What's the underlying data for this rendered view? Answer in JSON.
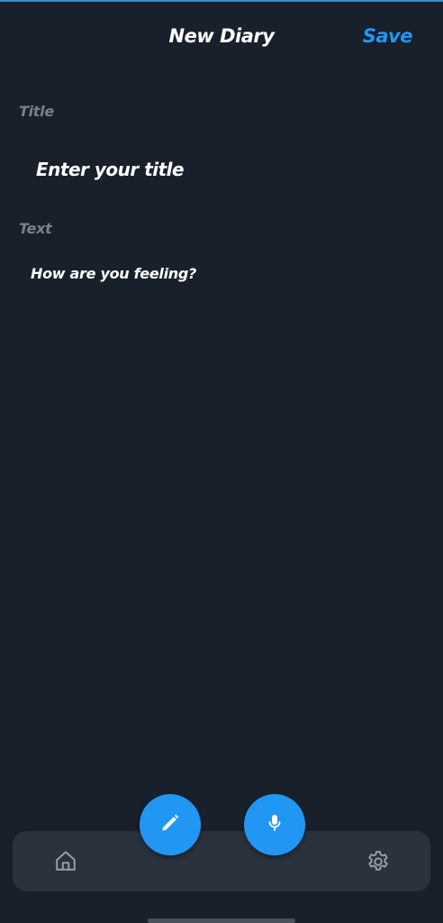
{
  "header": {
    "title": "New Diary",
    "save_label": "Save"
  },
  "form": {
    "title_label": "Title",
    "title_placeholder": "Enter your title",
    "title_value": "",
    "text_label": "Text",
    "text_placeholder": "How are you feeling?",
    "text_value": ""
  },
  "bottom_nav": {
    "left_icon": "home-icon",
    "right_icon": "gear-icon"
  },
  "fabs": {
    "edit_icon": "pencil-icon",
    "mic_icon": "microphone-icon"
  },
  "colors": {
    "background": "#18202b",
    "accent": "#2196f3",
    "nav_bar": "#2a323d",
    "label_gray": "#7b7f86"
  }
}
